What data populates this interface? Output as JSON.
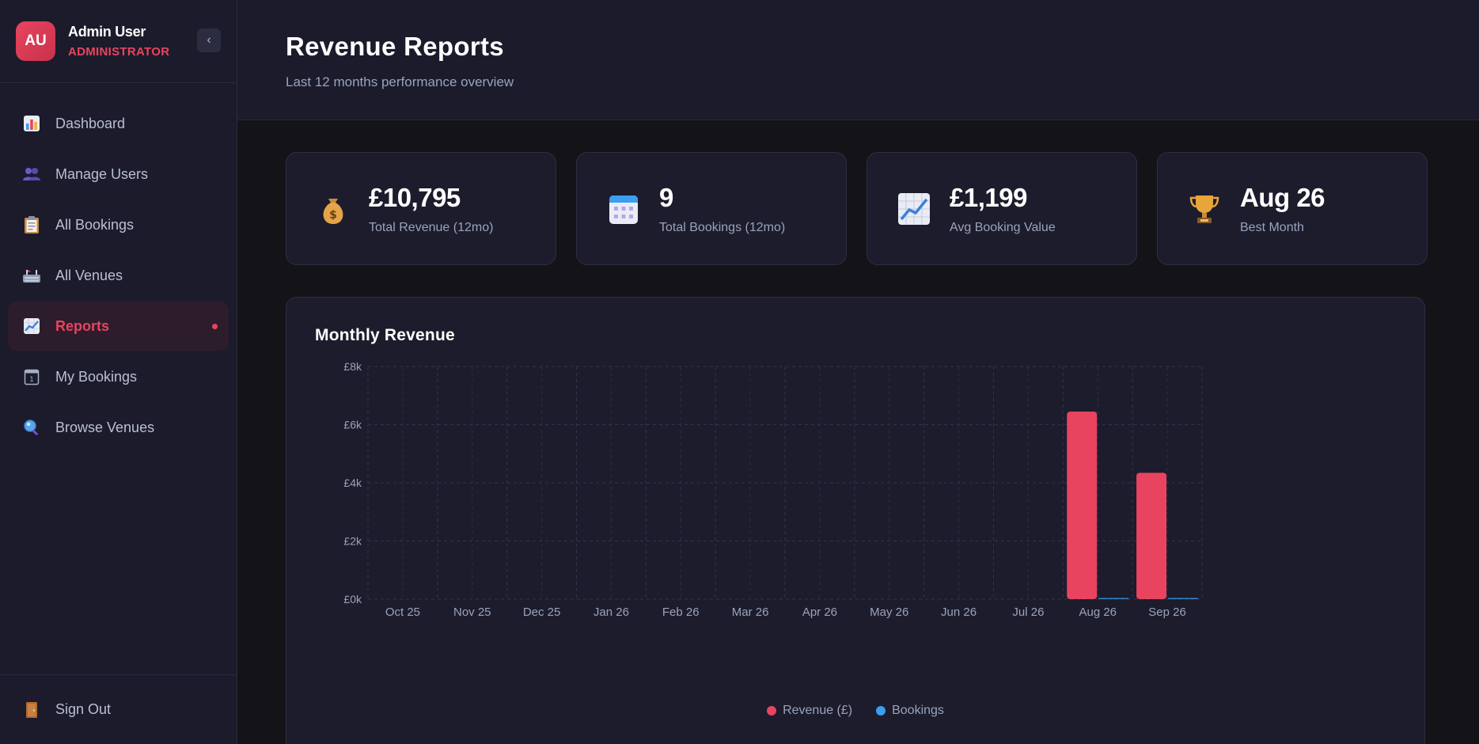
{
  "user": {
    "initials": "AU",
    "name": "Admin User",
    "role": "ADMINISTRATOR"
  },
  "sidebar": {
    "collapse_icon": "‹",
    "items": [
      {
        "label": "Dashboard",
        "icon": "bar-chart-icon",
        "active": false
      },
      {
        "label": "Manage Users",
        "icon": "users-icon",
        "active": false
      },
      {
        "label": "All Bookings",
        "icon": "clipboard-icon",
        "active": false
      },
      {
        "label": "All Venues",
        "icon": "stadium-icon",
        "active": false
      },
      {
        "label": "Reports",
        "icon": "trend-chart-icon",
        "active": true
      },
      {
        "label": "My Bookings",
        "icon": "calendar-icon",
        "active": false
      },
      {
        "label": "Browse Venues",
        "icon": "magnifier-icon",
        "active": false
      }
    ],
    "signout_label": "Sign Out"
  },
  "header": {
    "title": "Revenue Reports",
    "subtitle": "Last 12 months performance overview"
  },
  "stats": [
    {
      "value": "£10,795",
      "label": "Total Revenue (12mo)",
      "icon": "money-bag-icon"
    },
    {
      "value": "9",
      "label": "Total Bookings (12mo)",
      "icon": "calendar-icon"
    },
    {
      "value": "£1,199",
      "label": "Avg Booking Value",
      "icon": "trend-chart-icon"
    },
    {
      "value": "Aug 26",
      "label": "Best Month",
      "icon": "trophy-icon"
    }
  ],
  "chart": {
    "title": "Monthly Revenue"
  },
  "colors": {
    "accent": "#e8445f",
    "bookings": "#3b9ef0",
    "background": "#131318",
    "card": "#1c1c2c"
  },
  "chart_data": {
    "type": "bar",
    "categories": [
      "Oct 25",
      "Nov 25",
      "Dec 25",
      "Jan 26",
      "Feb 26",
      "Mar 26",
      "Apr 26",
      "May 26",
      "Jun 26",
      "Jul 26",
      "Aug 26",
      "Sep 26"
    ],
    "series": [
      {
        "name": "Revenue (£)",
        "values": [
          0,
          0,
          0,
          0,
          0,
          0,
          0,
          0,
          0,
          0,
          6450,
          4345
        ],
        "color": "#e8445f"
      },
      {
        "name": "Bookings",
        "values": [
          0,
          0,
          0,
          0,
          0,
          0,
          0,
          0,
          0,
          0,
          5,
          4
        ],
        "color": "#3b9ef0"
      }
    ],
    "y_ticks": [
      "£0k",
      "£2k",
      "£4k",
      "£6k",
      "£8k"
    ],
    "ylim": [
      0,
      8000
    ],
    "grid": true,
    "legend": "bottom-center"
  }
}
